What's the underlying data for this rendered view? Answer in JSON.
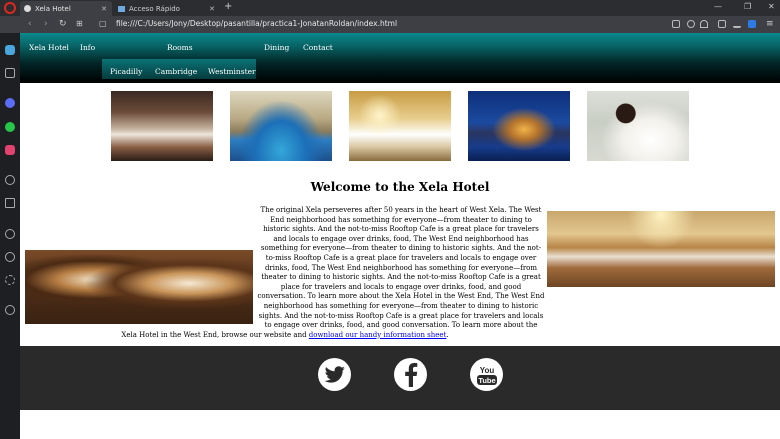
{
  "browser": {
    "tabs": [
      {
        "label": "Xela Hotel",
        "active": true
      },
      {
        "label": "Acceso Rápido",
        "active": false
      }
    ],
    "url": "file:///C:/Users/Jony/Desktop/pasantilla/practica1-JonatanRoldan/index.html"
  },
  "site": {
    "nav": {
      "brand": "Xela Hotel",
      "info": "Info",
      "rooms": "Rooms",
      "dining": "Dining",
      "contact": "Contact"
    },
    "rooms_submenu": [
      "Picadilly",
      "Cambridge",
      "Westminster"
    ],
    "title": "Welcome to the Xela Hotel",
    "paragraph": "The original Xela perseveres after 50 years in the heart of West Xela. The West End neighborhood has something for everyone—from theater to dining to historic sights. And the not-to-miss Rooftop Cafe is a great place for travelers and locals to engage over drinks, food, The West End neighborhood has something for everyone—from theater to dining to historic sights. And the not-to-miss Rooftop Cafe is a great place for travelers and locals to engage over drinks, food, The West End neighborhood has something for everyone—from theater to dining to historic sights. And the not-to-miss Rooftop Cafe is a great place for travelers and locals to engage over drinks, food, and good  conversation.  To learn more about the Xela Hotel in the West End, The West End neighborhood has something for everyone—from theater to dining to historic sights. And the not-to-miss Rooftop Cafe is a great place for travelers and locals to engage over drinks, food, and good conversation. To learn more about the Xela Hotel in the West End, browse our website and",
    "link_text": "download our handy information sheet",
    "link_suffix": ".",
    "social": [
      "twitter-icon",
      "facebook-icon",
      "youtube-icon"
    ]
  },
  "colors": {
    "header_teal": "#0b8a8d",
    "footer": "#2b2a2a",
    "link": "#0000ee"
  }
}
